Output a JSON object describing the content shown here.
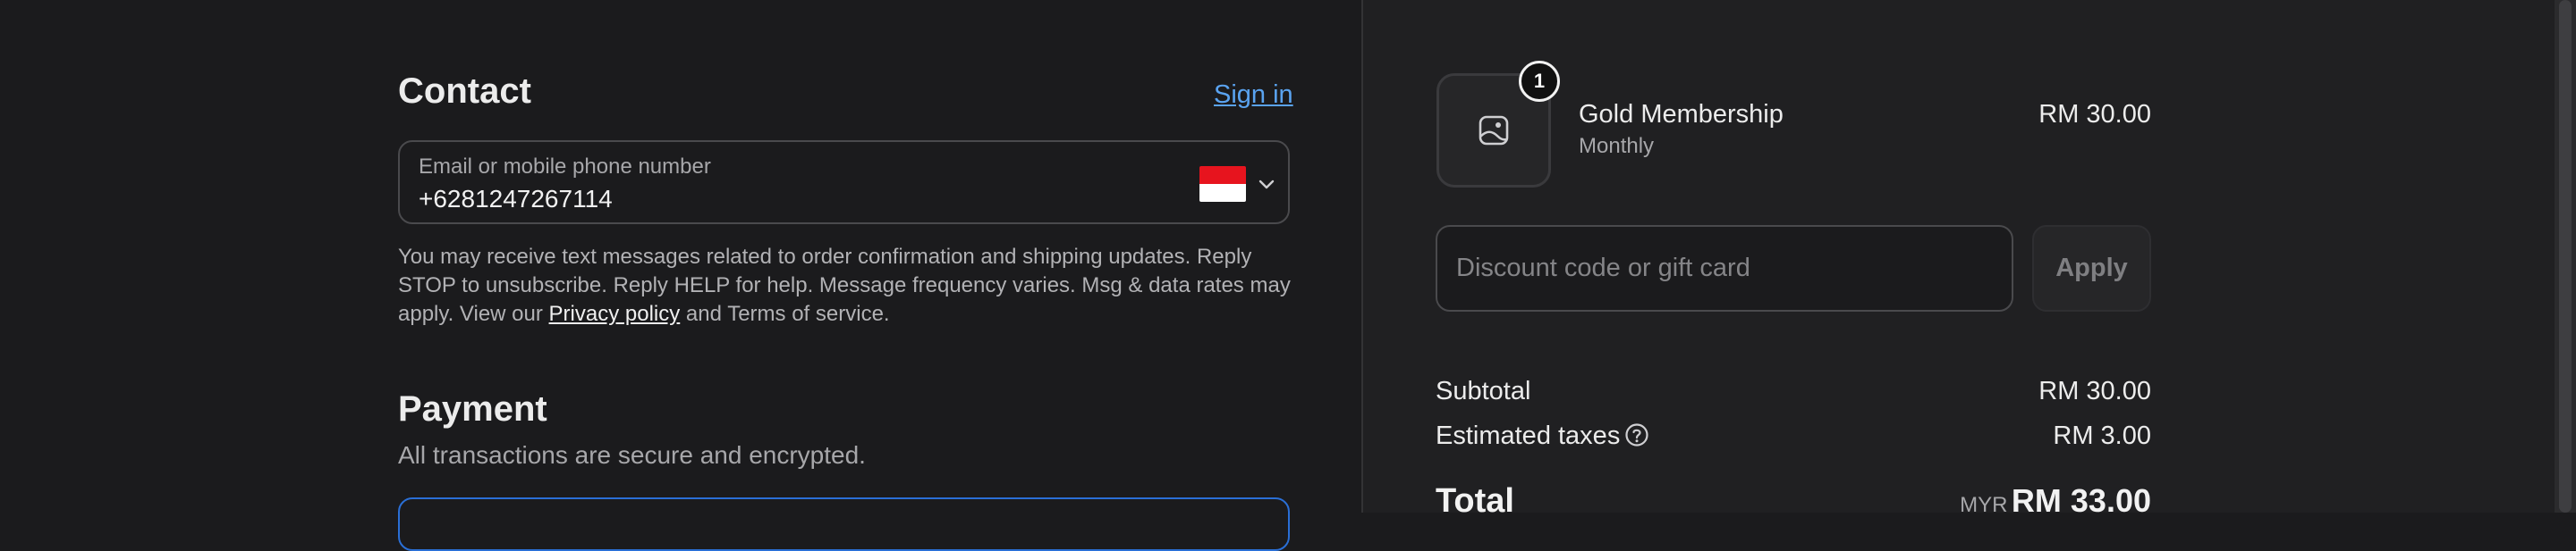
{
  "contact": {
    "title": "Contact",
    "sign_in": "Sign in",
    "field_label": "Email or mobile phone number",
    "field_value": "+6281247267114",
    "sms_before": "You may receive text messages related to order confirmation and shipping updates. Reply STOP to unsubscribe. Reply HELP for help. Message frequency varies. Msg & data rates may apply. View our ",
    "privacy_link": "Privacy policy",
    "sms_after": " and Terms of service."
  },
  "payment": {
    "title": "Payment",
    "subtitle": "All transactions are secure and encrypted."
  },
  "order": {
    "quantity": "1",
    "product_name": "Gold Membership",
    "product_plan": "Monthly",
    "product_price": "RM 30.00",
    "discount_placeholder": "Discount code or gift card",
    "apply_label": "Apply",
    "subtotal_label": "Subtotal",
    "subtotal_value": "RM 30.00",
    "taxes_label": "Estimated taxes",
    "taxes_value": "RM 3.00",
    "total_label": "Total",
    "currency": "MYR",
    "total_value": "RM 33.00"
  },
  "colors": {
    "link": "#5aa3f0",
    "flag_red": "#e7141e",
    "payment_border": "#2a6fd6"
  }
}
